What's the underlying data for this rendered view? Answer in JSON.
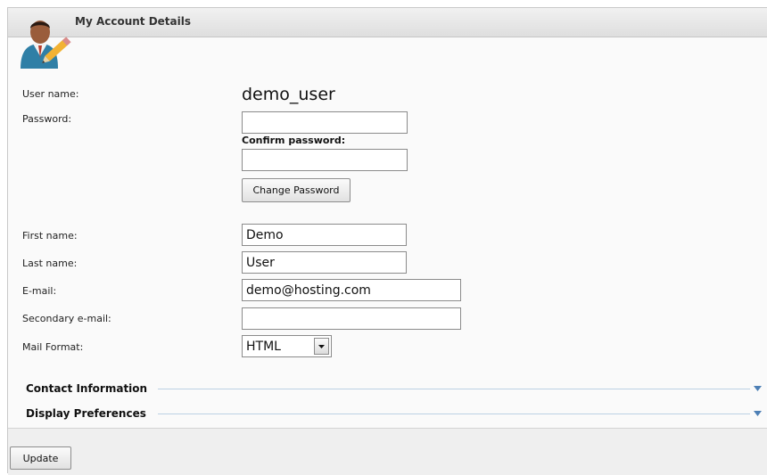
{
  "header": {
    "title": "My Account Details",
    "avatar_icon": "user-edit-icon"
  },
  "form": {
    "username_label": "User name:",
    "username_value": "demo_user",
    "password_label": "Password:",
    "password_value": "",
    "confirm_label": "Confirm password:",
    "confirm_value": "",
    "change_password_button": "Change Password",
    "first_name_label": "First name:",
    "first_name_value": "Demo",
    "last_name_label": "Last name:",
    "last_name_value": "User",
    "email_label": "E-mail:",
    "email_value": "demo@hosting.com",
    "secondary_email_label": "Secondary e-mail:",
    "secondary_email_value": "",
    "mail_format_label": "Mail Format:",
    "mail_format_value": "HTML"
  },
  "sections": [
    {
      "label": "Contact Information",
      "toggle_icon": "chevron-down-icon"
    },
    {
      "label": "Display Preferences",
      "toggle_icon": "chevron-down-icon"
    }
  ],
  "footer": {
    "update_button": "Update"
  },
  "colors": {
    "section_line": "#bcd1e3",
    "toggle_arrow": "#4d7fb5"
  }
}
